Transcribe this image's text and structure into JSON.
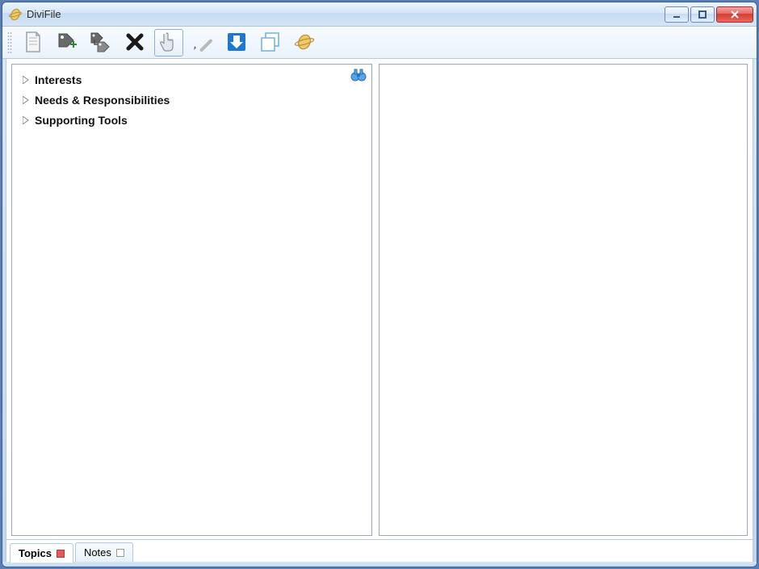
{
  "window": {
    "title": "DiviFile"
  },
  "tree": {
    "items": [
      {
        "label": "Interests"
      },
      {
        "label": "Needs & Responsibilities"
      },
      {
        "label": "Supporting Tools"
      }
    ]
  },
  "tabs": {
    "topics": "Topics",
    "notes": "Notes"
  }
}
